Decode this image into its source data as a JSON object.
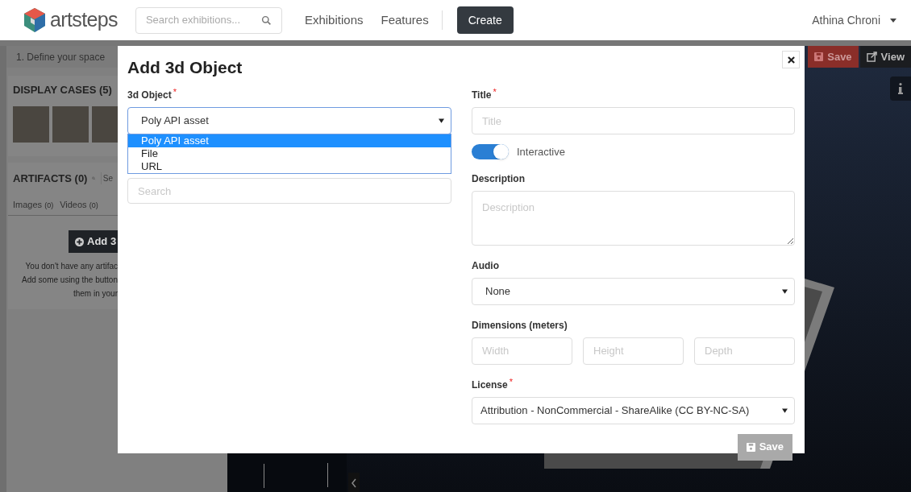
{
  "header": {
    "logo_text": "artsteps",
    "search_placeholder": "Search exhibitions...",
    "nav": [
      "Exhibitions",
      "Features"
    ],
    "create": "Create",
    "user": "Athina Chroni"
  },
  "editor": {
    "step": "1. Define your space",
    "display_cases": "DISPLAY CASES (5)",
    "artifacts": "ARTIFACTS (0)",
    "artifact_search": "Se",
    "tabs": [
      {
        "label": "Images",
        "count": "(0)"
      },
      {
        "label": "Videos",
        "count": "(0)"
      }
    ],
    "add_button": "Add 3",
    "empty_text": [
      "You don't have any artifac",
      "Add some using the button",
      "them in your"
    ],
    "toolbar": [
      "Save",
      "View"
    ]
  },
  "modal": {
    "title": "Add 3d Object",
    "object": {
      "label": "3d Object",
      "required_mark": "*",
      "value": "Poly API asset",
      "open": true,
      "options": [
        {
          "label": "Poly API asset",
          "selected": true
        },
        {
          "label": "File",
          "selected": false
        },
        {
          "label": "URL",
          "selected": false
        }
      ]
    },
    "search_placeholder": "Search",
    "title_field": {
      "label": "Title",
      "required_mark": "*",
      "placeholder": "Title"
    },
    "interactive": {
      "label": "Interactive",
      "on": true
    },
    "description": {
      "label": "Description",
      "placeholder": "Description"
    },
    "audio": {
      "label": "Audio",
      "value": "None"
    },
    "dimensions": {
      "label": "Dimensions (meters)",
      "placeholders": [
        "Width",
        "Height",
        "Depth"
      ]
    },
    "license": {
      "label": "License",
      "required_mark": "*",
      "value": "Attribution - NonCommercial - ShareAlike (CC BY-NC-SA)"
    },
    "save": {
      "label": "Save",
      "disabled": true
    }
  }
}
